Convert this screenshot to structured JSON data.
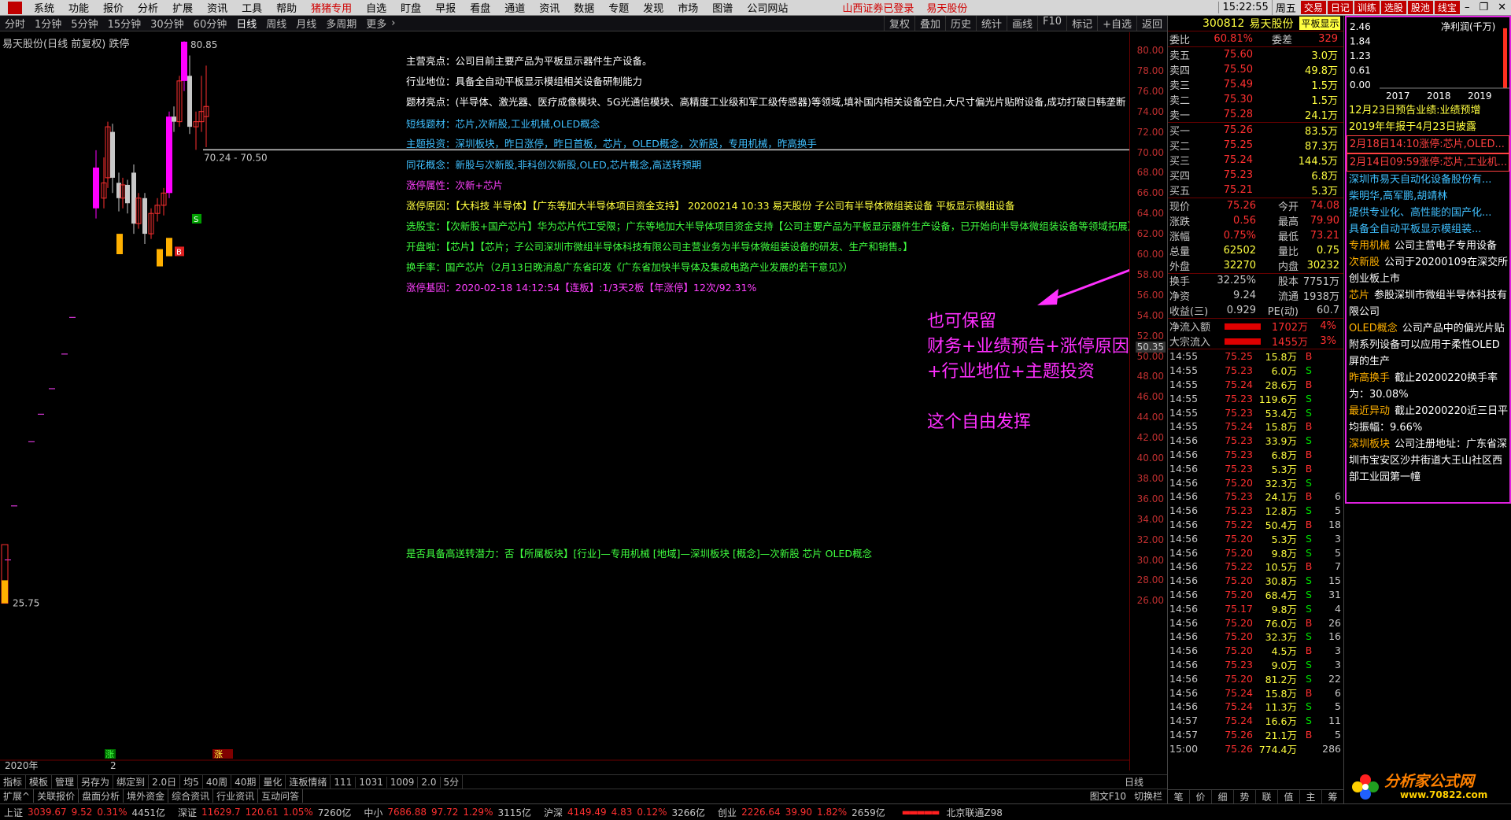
{
  "menubar": {
    "items": [
      "系统",
      "功能",
      "报价",
      "分析",
      "扩展",
      "资讯",
      "工具",
      "帮助",
      "猪猪专用",
      "自选",
      "盯盘",
      "早报",
      "看盘",
      "通道",
      "资讯",
      "数据",
      "专题",
      "发现",
      "市场",
      "图谱",
      "公司网站"
    ],
    "status": "山西证券已登录",
    "stock": "易天股份",
    "time": "15:22:55",
    "weekday": "周五",
    "buttons": [
      "交易",
      "日记",
      "训练",
      "选股",
      "股池",
      "线宝"
    ]
  },
  "period": {
    "items": [
      "分时",
      "1分钟",
      "5分钟",
      "15分钟",
      "30分钟",
      "60分钟",
      "日线",
      "周线",
      "月线",
      "多周期",
      "更多"
    ],
    "active": "日线",
    "tools": [
      "复权",
      "叠加",
      "历史",
      "统计",
      "画线",
      "F10",
      "标记",
      "+自选",
      "返回"
    ]
  },
  "chart": {
    "title": "易天股份(日线 前复权)",
    "title_suffix": "跌停",
    "high_label": "80.85",
    "low_label": "25.75",
    "range_label": "70.24 - 70.50",
    "price_marker": "50.35",
    "year_label": "2020年",
    "month_label": "2",
    "zt_label": "涨",
    "tag_b": "B",
    "tag_s": "S",
    "y_ticks": [
      "80.00",
      "78.00",
      "76.00",
      "74.00",
      "72.00",
      "70.00",
      "68.00",
      "66.00",
      "64.00",
      "62.00",
      "60.00",
      "58.00",
      "56.00",
      "54.00",
      "52.00",
      "50.00",
      "48.00",
      "46.00",
      "44.00",
      "42.00",
      "40.00",
      "38.00",
      "36.00",
      "34.00",
      "32.00",
      "30.00",
      "28.00",
      "26.00"
    ]
  },
  "info": {
    "lines": [
      {
        "text": "主营亮点：公司目前主要产品为平板显示器件生产设备。",
        "color": "#ffffff"
      },
      {
        "text": "行业地位：具备全自动平板显示模组相关设备研制能力",
        "color": "#ffffff"
      },
      {
        "text": "题材亮点：(半导体、激光器、医疗成像模块、5G光通信模块、高精度工业级和军工级传感器)等领域,填补国内相关设备空白,大尺寸偏光片贴附设备,成功打破日韩垄断",
        "color": "#ffffff"
      },
      {
        "text": "短线题材：芯片,次新股,工业机械,OLED概念",
        "color": "#40c0ff"
      },
      {
        "text": "主题投资：深圳板块，昨日涨停，昨日首板，芯片，OLED概念，次新股，专用机械，昨高换手",
        "color": "#40c0ff"
      },
      {
        "text": "同花概念：新股与次新股,非科创次新股,OLED,芯片概念,高送转预期",
        "color": "#40c0ff"
      },
      {
        "text": "涨停属性：次新+芯片",
        "color": "#ff40ff"
      },
      {
        "text": "涨停原因：【大科技 半导体】【广东等加大半导体项目资金支持】 20200214 10:33 易天股份 子公司有半导体微组装设备 平板显示模组设备",
        "color": "#ffff40"
      },
      {
        "text": "选股宝：【次新股+国产芯片】华为芯片代工受限；广东等地加大半导体项目资金支持【公司主要产品为平板显示器件生产设备，已开始向半导体微组装设备等领域拓展】",
        "color": "#40ff40"
      },
      {
        "text": "开盘啦：【芯片】【芯片；子公司深圳市微组半导体科技有限公司主营业务为半导体微组装设备的研发、生产和销售。】",
        "color": "#40ff40"
      },
      {
        "text": "换手率：国产芯片（2月13日晚消息广东省印发《广东省加快半导体及集成电路产业发展的若干意见》）",
        "color": "#40ff40"
      },
      {
        "text": "涨停基因：2020-02-18 14:12:54【连板】:1/3天2板【年涨停】12次/92.31%",
        "color": "#ff40ff"
      },
      {
        "text": "是否具备高送转潜力：否【所属板块】[行业]—专用机械 [地域]—深圳板块 [概念]—次新股 芯片 OLED概念",
        "color": "#40ff40"
      }
    ]
  },
  "annotation": {
    "lines": [
      "也可保留",
      "财务+业绩预告+涨停原因",
      "+行业地位+主题投资",
      "",
      "这个自由发挥"
    ]
  },
  "bottombar": {
    "items": [
      "指标",
      "模板",
      "管理",
      "另存为",
      "绑定到",
      "2.0日",
      "均5",
      "40周",
      "40期",
      "量化",
      "连板情绪",
      "111",
      "1031",
      "1009",
      "2.0",
      "5分"
    ],
    "right": "日线"
  },
  "tabbar": {
    "items": [
      "扩展^",
      "关联报价",
      "盘面分析",
      "境外资金",
      "综合资讯",
      "行业资讯",
      "互动问答"
    ],
    "right1": "图文F10",
    "right2": "切换栏"
  },
  "indexbar": [
    {
      "name": "上证",
      "v": "3039.67",
      "c": "9.52",
      "pct": "0.31%",
      "amt": "4451亿"
    },
    {
      "name": "深证",
      "v": "11629.7",
      "c": "120.61",
      "pct": "1.05%",
      "amt": "7260亿"
    },
    {
      "name": "中小",
      "v": "7686.88",
      "c": "97.72",
      "pct": "1.29%",
      "amt": "3115亿"
    },
    {
      "name": "沪深",
      "v": "4149.49",
      "c": "4.83",
      "pct": "0.12%",
      "amt": "3266亿"
    },
    {
      "name": "创业",
      "v": "2226.64",
      "c": "39.90",
      "pct": "1.82%",
      "amt": "2659亿"
    }
  ],
  "indexbar_extra": "北京联通Z98",
  "quote": {
    "code": "300812",
    "name": "易天股份",
    "badge": "平板显示",
    "webi": {
      "label": "委比",
      "val": "60.81%",
      "label2": "委差",
      "val2": "329"
    },
    "sells": [
      [
        "卖五",
        "75.60",
        "3.0万"
      ],
      [
        "卖四",
        "75.50",
        "49.8万"
      ],
      [
        "卖三",
        "75.49",
        "1.5万"
      ],
      [
        "卖二",
        "75.30",
        "1.5万"
      ],
      [
        "卖一",
        "75.28",
        "24.1万"
      ]
    ],
    "buys": [
      [
        "买一",
        "75.26",
        "83.5万"
      ],
      [
        "买二",
        "75.25",
        "87.3万"
      ],
      [
        "买三",
        "75.24",
        "144.5万"
      ],
      [
        "买四",
        "75.23",
        "6.8万"
      ],
      [
        "买五",
        "75.21",
        "5.3万"
      ]
    ],
    "stats": [
      [
        "现价",
        "75.26",
        "今开",
        "74.08"
      ],
      [
        "涨跌",
        "0.56",
        "最高",
        "79.90"
      ],
      [
        "涨幅",
        "0.75%",
        "最低",
        "73.21"
      ],
      [
        "总量",
        "62502",
        "量比",
        "0.75"
      ],
      [
        "外盘",
        "32270",
        "内盘",
        "30232"
      ],
      [
        "换手",
        "32.25%",
        "股本",
        "7751万"
      ],
      [
        "净资",
        "9.24",
        "流通",
        "1938万"
      ],
      [
        "收益(三)",
        "0.929",
        "PE(动)",
        "60.7"
      ]
    ],
    "flows": [
      [
        "净流入额",
        "1702万",
        "4%"
      ],
      [
        "大宗流入",
        "1455万",
        "3%"
      ]
    ],
    "ticks": [
      [
        "14:55",
        "75.25",
        "15.8万",
        "B",
        ""
      ],
      [
        "14:55",
        "75.23",
        "6.0万",
        "S",
        ""
      ],
      [
        "14:55",
        "75.24",
        "28.6万",
        "B",
        ""
      ],
      [
        "14:55",
        "75.23",
        "119.6万",
        "S",
        ""
      ],
      [
        "14:55",
        "75.23",
        "53.4万",
        "S",
        ""
      ],
      [
        "14:55",
        "75.24",
        "15.8万",
        "B",
        ""
      ],
      [
        "14:56",
        "75.23",
        "33.9万",
        "S",
        ""
      ],
      [
        "14:56",
        "75.23",
        "6.8万",
        "B",
        ""
      ],
      [
        "14:56",
        "75.23",
        "5.3万",
        "B",
        ""
      ],
      [
        "14:56",
        "75.20",
        "32.3万",
        "S",
        ""
      ],
      [
        "14:56",
        "75.23",
        "24.1万",
        "B",
        "6"
      ],
      [
        "14:56",
        "75.23",
        "12.8万",
        "S",
        "5"
      ],
      [
        "14:56",
        "75.22",
        "50.4万",
        "B",
        "18"
      ],
      [
        "14:56",
        "75.20",
        "5.3万",
        "S",
        "3"
      ],
      [
        "14:56",
        "75.20",
        "9.8万",
        "S",
        "5"
      ],
      [
        "14:56",
        "75.22",
        "10.5万",
        "B",
        "7"
      ],
      [
        "14:56",
        "75.20",
        "30.8万",
        "S",
        "15"
      ],
      [
        "14:56",
        "75.20",
        "68.4万",
        "S",
        "31"
      ],
      [
        "14:56",
        "75.17",
        "9.8万",
        "S",
        "4"
      ],
      [
        "14:56",
        "75.20",
        "76.0万",
        "B",
        "26"
      ],
      [
        "14:56",
        "75.20",
        "32.3万",
        "S",
        "16"
      ],
      [
        "14:56",
        "75.20",
        "4.5万",
        "B",
        "3"
      ],
      [
        "14:56",
        "75.23",
        "9.0万",
        "S",
        "3"
      ],
      [
        "14:56",
        "75.20",
        "81.2万",
        "S",
        "22"
      ],
      [
        "14:56",
        "75.24",
        "15.8万",
        "B",
        "6"
      ],
      [
        "14:56",
        "75.24",
        "11.3万",
        "S",
        "5"
      ],
      [
        "14:57",
        "75.24",
        "16.6万",
        "S",
        "11"
      ],
      [
        "14:57",
        "75.26",
        "21.1万",
        "B",
        "5"
      ],
      [
        "15:00",
        "75.26",
        "774.4万",
        "",
        "286"
      ]
    ],
    "footer": [
      "笔",
      "价",
      "细",
      "势",
      "联",
      "值",
      "主",
      "筹"
    ]
  },
  "fin": {
    "chart_data": {
      "type": "bar",
      "title": "净利润(千万)",
      "categories": [
        "2017",
        "2018",
        "2019"
      ],
      "values": [
        0,
        0,
        2.4
      ],
      "yticks": [
        "2.46",
        "1.84",
        "1.23",
        "0.61",
        "0.00"
      ],
      "ylim": [
        0,
        2.46
      ]
    },
    "lines": [
      {
        "t": "12月23日预告业绩:业绩预增",
        "c": "#ffff40"
      },
      {
        "t": "2019年年报于4月23日披露",
        "c": "#ffff40"
      },
      {
        "t": "2月18日14:10涨停:芯片,OLED...",
        "c": "#ff4040"
      },
      {
        "t": "2月14日09:59涨停:芯片,工业机...",
        "c": "#ff4040"
      },
      {
        "t": "深圳市易天自动化设备股份有...",
        "c": "#40c0ff"
      },
      {
        "t": "柴明华,高军鹏,胡靖林",
        "c": "#40c0ff"
      },
      {
        "t": "提供专业化、高性能的国产化...",
        "c": "#40c0ff"
      },
      {
        "t": "具备全自动平板显示模组装...",
        "c": "#40c0ff"
      }
    ],
    "concepts": [
      {
        "k": "专用机械",
        "v": "公司主营电子专用设备"
      },
      {
        "k": "次新股",
        "v": "公司于20200109在深交所创业板上市"
      },
      {
        "k": "芯片",
        "v": "参股深圳市微组半导体科技有限公司"
      },
      {
        "k": "OLED概念",
        "v": "公司产品中的偏光片贴附系列设备可以应用于柔性OLED屏的生产"
      },
      {
        "k": "昨高换手",
        "v": "截止20200220换手率为：30.08%"
      },
      {
        "k": "最近异动",
        "v": "截止20200220近三日平均振幅：9.66%"
      },
      {
        "k": "深圳板块",
        "v": "公司注册地址：广东省深圳市宝安区沙井街道大王山社区西部工业园第一幢"
      }
    ]
  },
  "logo": {
    "text": "分析家公式网",
    "url": "www.70822.com"
  },
  "colors": {
    "up": "#ff3030",
    "down": "#00e0e0",
    "zt": "#ff00ff",
    "yellow": "#ffb000"
  }
}
